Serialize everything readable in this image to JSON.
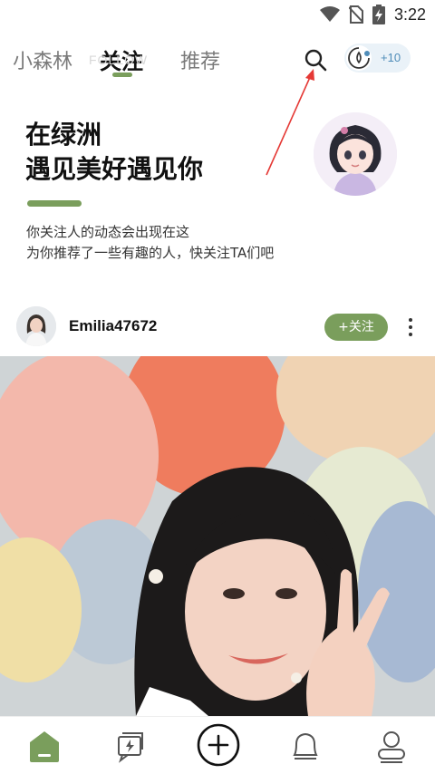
{
  "status_bar": {
    "time": "3:22",
    "icons": [
      "wifi-icon",
      "no-sim-icon",
      "battery-charging-icon"
    ]
  },
  "top_nav": {
    "tabs": [
      {
        "label": "小森林",
        "active": false
      },
      {
        "label": "关注",
        "active": true
      },
      {
        "label": "推荐",
        "active": false
      }
    ],
    "ghost_text": "FOLLOW",
    "search_icon": "search-icon",
    "points": {
      "icon": "water-drop-timer-icon",
      "value": "+10"
    }
  },
  "hero": {
    "title_lines": [
      "在绿洲",
      "遇见美好遇见你"
    ],
    "description_lines": [
      "你关注人的动态会出现在这",
      "为你推荐了一些有趣的人，快关注TA们吧"
    ]
  },
  "post": {
    "username": "Emilia47672",
    "follow_label": "+关注",
    "more_icon": "more-vertical-icon"
  },
  "bottom_nav": {
    "items": [
      {
        "icon": "home-icon",
        "active": true
      },
      {
        "icon": "message-icon",
        "active": false
      },
      {
        "icon": "add-icon",
        "active": false
      },
      {
        "icon": "bell-icon",
        "active": false
      },
      {
        "icon": "profile-icon",
        "active": false
      }
    ]
  },
  "colors": {
    "accent_green": "#7a9e5c",
    "points_blue": "#4e8cb8",
    "annotation_red": "#e53935"
  }
}
